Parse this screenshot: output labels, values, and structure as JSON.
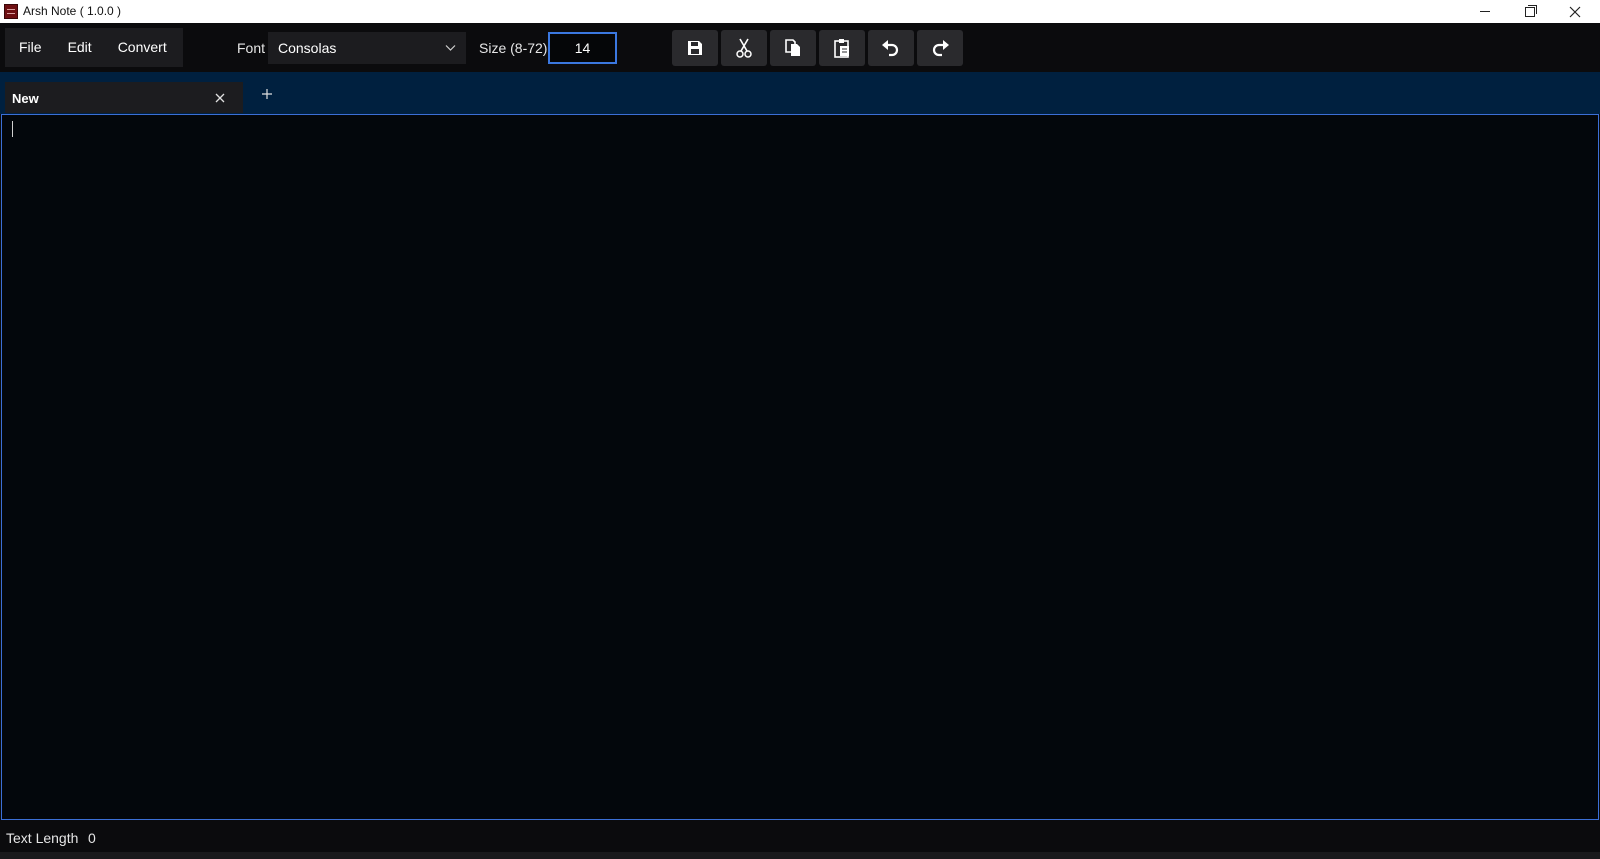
{
  "window": {
    "title": "Arsh Note ( 1.0.0 )"
  },
  "menu": {
    "items": [
      "File",
      "Edit",
      "Convert"
    ]
  },
  "font": {
    "label": "Font",
    "selected": "Consolas"
  },
  "size": {
    "label": "Size (8-72)",
    "value": "14"
  },
  "toolbar_icons": [
    "save-icon",
    "cut-icon",
    "copy-icon",
    "paste-icon",
    "undo-icon",
    "redo-icon"
  ],
  "tabs": [
    {
      "label": "New"
    }
  ],
  "editor": {
    "content": ""
  },
  "status": {
    "label": "Text Length",
    "value": "0"
  },
  "colors": {
    "accent": "#3b78e0",
    "tab_strip": "#00203f",
    "editor_bg": "#03070c"
  }
}
